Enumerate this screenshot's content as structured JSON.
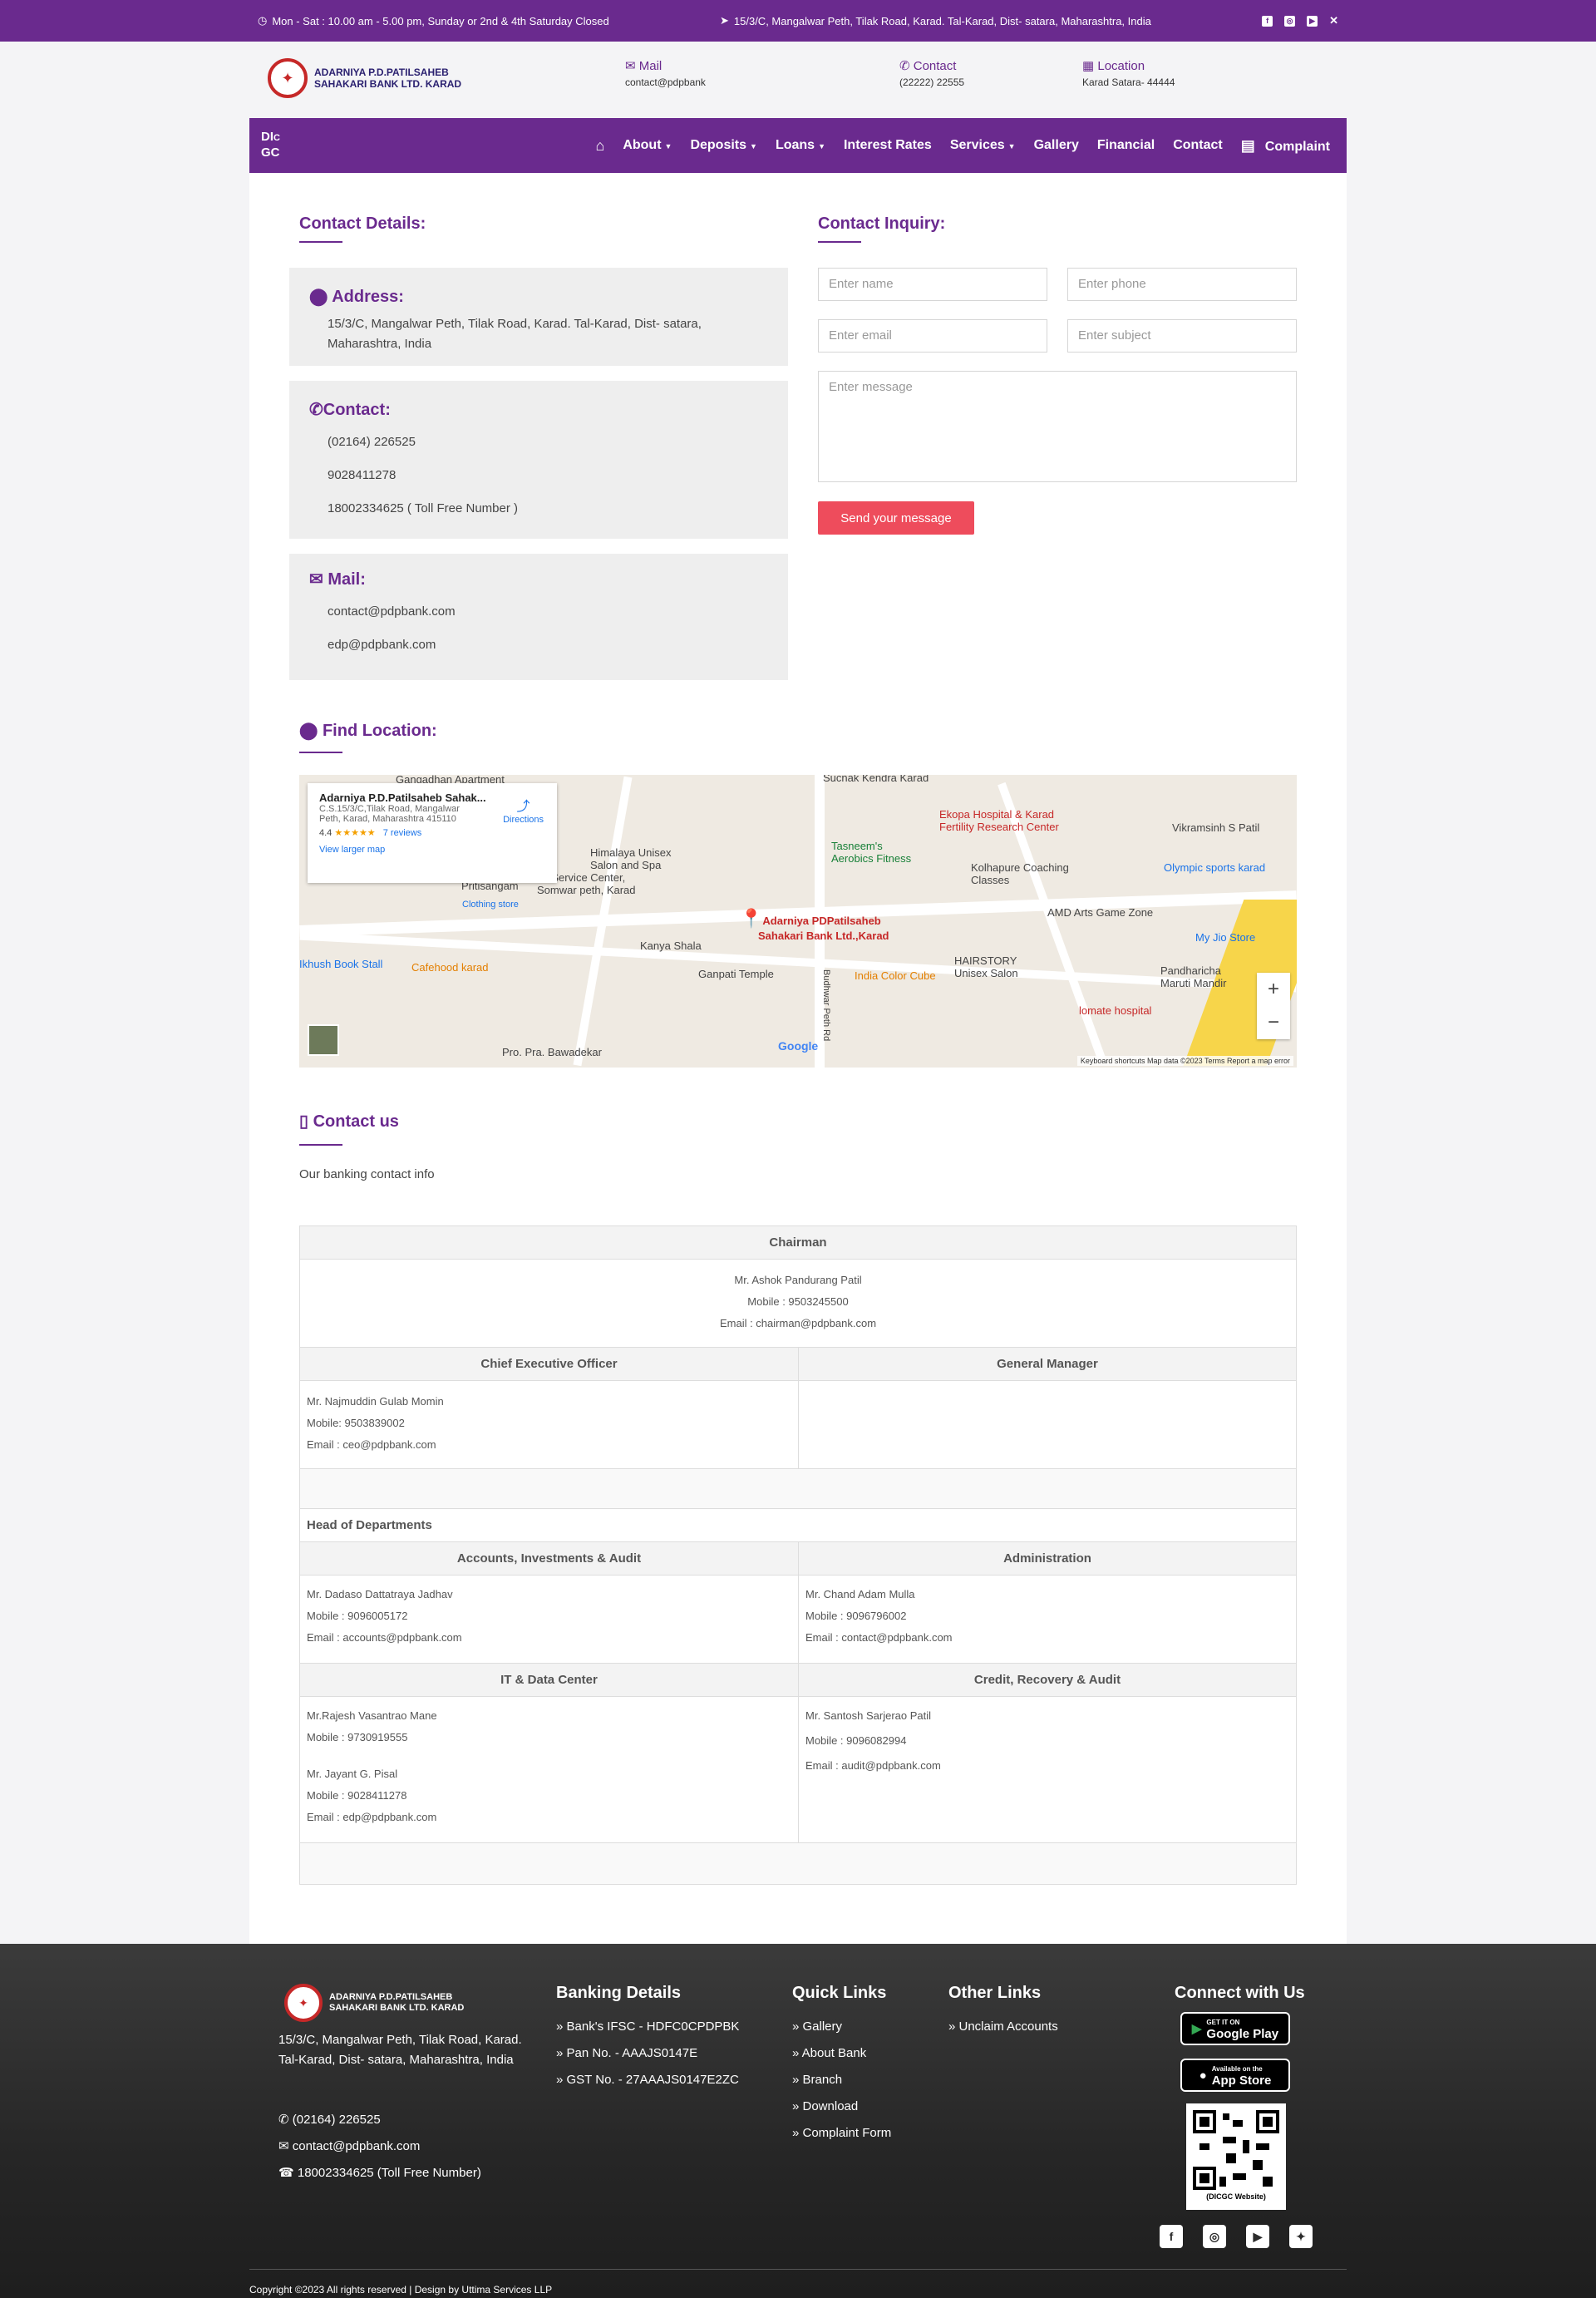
{
  "topbar": {
    "hours": "Mon - Sat : 10.00 am - 5.00 pm, Sunday or 2nd & 4th Saturday Closed",
    "address": "15/3/C, Mangalwar Peth, Tilak Road, Karad. Tal-Karad, Dist- satara, Maharashtra, India"
  },
  "brand": {
    "line1": "ADARNIYA P.D.PATILSAHEB",
    "line2": "SAHAKARI BANK LTD. KARAD"
  },
  "header": {
    "mail_label": "Mail",
    "mail_value": "contact@pdpbank",
    "contact_label": "Contact",
    "contact_value": "(22222) 22555",
    "location_label": "Location",
    "location_value": "Karad Satara- 44444"
  },
  "nav": {
    "dicgc": "DICGC",
    "items": [
      "About",
      "Deposits",
      "Loans",
      "Interest Rates",
      "Services",
      "Gallery",
      "Financial",
      "Contact",
      "Complaint"
    ]
  },
  "contact_details": {
    "title": "Contact Details:",
    "address_title": "Address:",
    "address": "15/3/C, Mangalwar Peth, Tilak Road, Karad. Tal-Karad, Dist- satara, Maharashtra, India",
    "contact_title": "Contact:",
    "phone1": "(02164) 226525",
    "phone2": "9028411278",
    "phone3": "18002334625 ( Toll Free Number )",
    "mail_title": "Mail:",
    "mail1": "contact@pdpbank.com",
    "mail2": "edp@pdpbank.com"
  },
  "inquiry": {
    "title": "Contact Inquiry:",
    "name": "Enter name",
    "phone": "Enter phone",
    "email": "Enter email",
    "subject": "Enter subject",
    "message": "Enter message",
    "send": "Send your message"
  },
  "location": {
    "title": "Find Location:"
  },
  "map": {
    "place_name": "Adarniya P.D.Patilsaheb Sahak...",
    "place_addr1": "C.S.15/3/C,Tilak Road, Mangalwar",
    "place_addr2": "Peth, Karad, Maharashtra 415110",
    "rating": "4.4",
    "stars": "★★★★★",
    "reviews": "7 reviews",
    "directions": "Directions",
    "larger": "View larger map",
    "pin_label1": "Adarniya PDPatilsaheb",
    "pin_label2": "Sahakari Bank Ltd.,Karad",
    "footer": "Keyboard shortcuts   Map data ©2023   Terms   Report a map error",
    "google": "Google",
    "labels": [
      "Ganpati Temple",
      "Kanya Shala",
      "India Color Cube",
      "HAIRSTORY Unisex Salon",
      "AMD Arts Game Zone",
      "Kolhapure Coaching Classes",
      "Ekopa Hospital & Karad Fertility Research Center",
      "Tasneem's Aerobics Fitness",
      "Himalaya Unisex Salon and Spa",
      "Pritisangam",
      "Cafehood karad",
      "Vikramsinh S Patil",
      "Olympic sports karad",
      "My Jio Store",
      "Pandharicha Maruti Mandir",
      "lomate hospital",
      "Pro. Pra. Bawadekar",
      "Budhwar Peth Rd",
      "Sucnak Kendra Karad",
      "Gangadhan Apartment",
      "Ikhush Book Stall",
      "Clothing store",
      "Mi Service Center, Somwar peth, Karad"
    ]
  },
  "contact_us": {
    "title": "Contact us",
    "subtitle": "Our banking contact info"
  },
  "table": {
    "chairman_title": "Chairman",
    "chairman_name": "Mr. Ashok Pandurang Patil",
    "chairman_mobile": "Mobile : 9503245500",
    "chairman_email": "Email : chairman@pdpbank.com",
    "ceo_title": "Chief Executive Officer",
    "gm_title": "General Manager",
    "ceo_name": "Mr. Najmuddin Gulab Momin",
    "ceo_mobile": "Mobile: 9503839002",
    "ceo_email": "Email : ceo@pdpbank.com",
    "hod": "Head of Departments",
    "acc_title": "Accounts, Investments & Audit",
    "acc_name": "Mr. Dadaso Dattatraya Jadhav",
    "acc_mobile": "Mobile : 9096005172",
    "acc_email": "Email : accounts@pdpbank.com",
    "adm_title": "Administration",
    "adm_name": "Mr. Chand Adam Mulla",
    "adm_mobile": "Mobile : 9096796002",
    "adm_email": "Email : contact@pdpbank.com",
    "it_title": "IT & Data Center",
    "it_name1": "Mr.Rajesh Vasantrao Mane",
    "it_mobile1": "Mobile : 9730919555",
    "it_name2": "Mr. Jayant G. Pisal",
    "it_mobile2": "Mobile : 9028411278",
    "it_email2": "Email : edp@pdpbank.com",
    "cr_title": "Credit, Recovery & Audit",
    "cr_name": "Mr. Santosh Sarjerao Patil",
    "cr_mobile": "Mobile : 9096082994",
    "cr_email": "Email : audit@pdpbank.com"
  },
  "footer": {
    "address": "15/3/C, Mangalwar Peth, Tilak Road, Karad. Tal-Karad, Dist- satara, Maharashtra, India",
    "phone": "(02164) 226525",
    "email": "contact@pdpbank.com",
    "tollfree": "18002334625 (Toll Free Number)",
    "banking_title": "Banking Details",
    "ifsc": "» Bank's IFSC - HDFC0CPDPBK",
    "pan": "» Pan No. - AAAJS0147E",
    "gst": "» GST No. - 27AAAJS0147E2ZC",
    "quick_title": "Quick Links",
    "quick": [
      "» Gallery",
      "» About Bank",
      "» Branch",
      "» Download",
      "» Complaint Form"
    ],
    "other_title": "Other Links",
    "other": [
      "» Unclaim Accounts"
    ],
    "connect_title": "Connect with Us",
    "google_play": "Google Play",
    "google_play_small": "GET IT ON",
    "app_store": "App Store",
    "app_store_small": "Available on the",
    "qr_caption": "(DICGC Website)",
    "copyright": "Copyright ©2023 All rights reserved | Design by Uttima Services LLP"
  },
  "colors": {
    "primary": "#6a2a8e",
    "button": "#ee4c5c",
    "footer": "#2c2c2c"
  }
}
